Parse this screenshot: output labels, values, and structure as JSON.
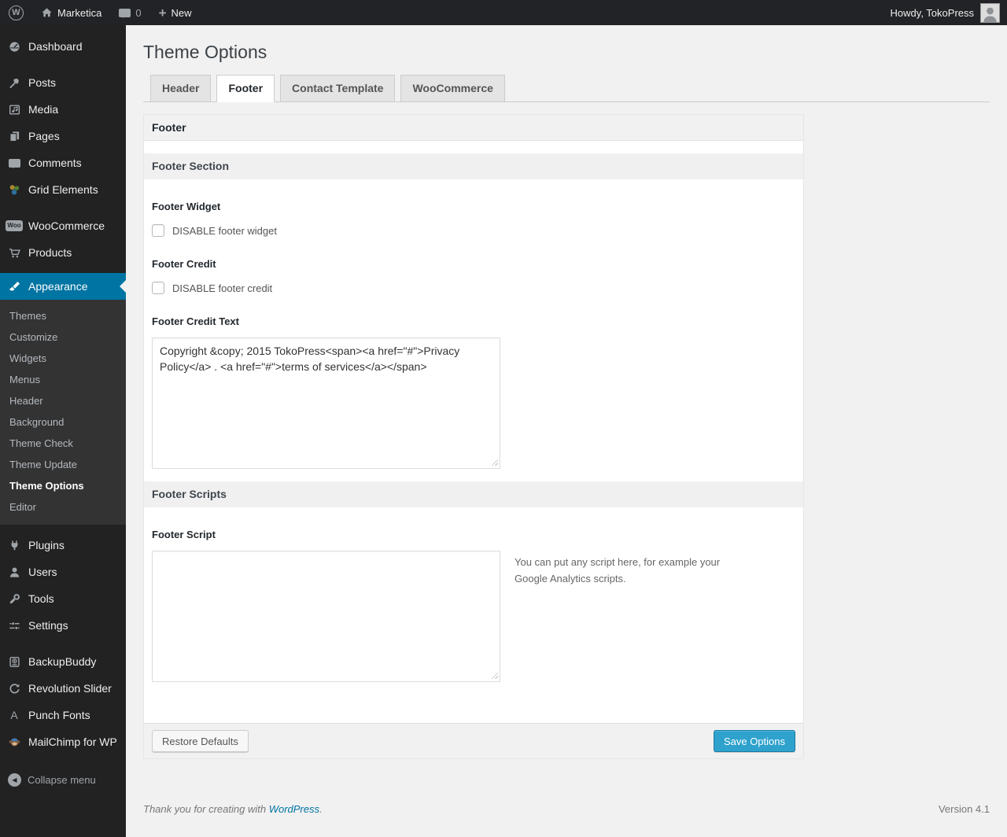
{
  "admin_bar": {
    "site_name": "Marketica",
    "comment_count": "0",
    "new_label": "New",
    "howdy_text": "Howdy, TokoPress"
  },
  "icon_text": {
    "wp_logo": "W",
    "new_plus": "+",
    "woo_badge": "Woo",
    "punch_fonts": "A",
    "collapse_arrow": "◀"
  },
  "sidebar": {
    "items": [
      {
        "label": "Dashboard",
        "icon": "dashboard-icon"
      },
      {
        "label": "Posts",
        "icon": "pushpin-icon"
      },
      {
        "label": "Media",
        "icon": "media-icon"
      },
      {
        "label": "Pages",
        "icon": "pages-icon"
      },
      {
        "label": "Comments",
        "icon": "comment-bubble-icon"
      },
      {
        "label": "Grid Elements",
        "icon": "grid-elements-icon"
      },
      {
        "label": "WooCommerce",
        "icon": "woocommerce-icon"
      },
      {
        "label": "Products",
        "icon": "cart-icon"
      },
      {
        "label": "Appearance",
        "icon": "brush-icon",
        "active": true
      },
      {
        "label": "Plugins",
        "icon": "plug-icon"
      },
      {
        "label": "Users",
        "icon": "user-icon"
      },
      {
        "label": "Tools",
        "icon": "wrench-icon"
      },
      {
        "label": "Settings",
        "icon": "sliders-icon"
      },
      {
        "label": "BackupBuddy",
        "icon": "backup-drive-icon"
      },
      {
        "label": "Revolution Slider",
        "icon": "refresh-icon"
      },
      {
        "label": "Punch Fonts",
        "icon": "letter-a-icon"
      },
      {
        "label": "MailChimp for WP",
        "icon": "monkey-icon"
      }
    ],
    "appearance_submenu": [
      {
        "label": "Themes"
      },
      {
        "label": "Customize"
      },
      {
        "label": "Widgets"
      },
      {
        "label": "Menus"
      },
      {
        "label": "Header"
      },
      {
        "label": "Background"
      },
      {
        "label": "Theme Check"
      },
      {
        "label": "Theme Update"
      },
      {
        "label": "Theme Options",
        "current": true
      },
      {
        "label": "Editor"
      }
    ],
    "collapse_label": "Collapse menu"
  },
  "page": {
    "title": "Theme Options",
    "tabs": [
      {
        "label": "Header",
        "active": false
      },
      {
        "label": "Footer",
        "active": true
      },
      {
        "label": "Contact Template",
        "active": false
      },
      {
        "label": "WooCommerce",
        "active": false
      }
    ]
  },
  "panel": {
    "header_title": "Footer",
    "section_title": "Footer Section",
    "footer_widget": {
      "label": "Footer Widget",
      "checkbox_label": "DISABLE footer widget",
      "checked": false
    },
    "footer_credit": {
      "label": "Footer Credit",
      "checkbox_label": "DISABLE footer credit",
      "checked": false
    },
    "footer_credit_text": {
      "label": "Footer Credit Text",
      "value": "Copyright &copy; 2015 TokoPress<span><a href=\"#\">Privacy Policy</a> . <a href=\"#\">terms of services</a></span>"
    },
    "scripts_section_title": "Footer Scripts",
    "footer_script": {
      "label": "Footer Script",
      "value": "",
      "help": "You can put any script here, for example your Google Analytics scripts."
    },
    "restore_button": "Restore Defaults",
    "save_button": "Save Options"
  },
  "page_footer": {
    "thanks_prefix": "Thank you for creating with ",
    "wordpress_link": "WordPress",
    "period": ".",
    "version": "Version 4.1"
  },
  "colors": {
    "accent_blue": "#0074a2",
    "primary_button": "#2ea2cc",
    "admin_bar_bg": "#222326",
    "sidebar_bg": "#222222",
    "submenu_bg": "#333333",
    "content_bg": "#f1f1f1"
  }
}
